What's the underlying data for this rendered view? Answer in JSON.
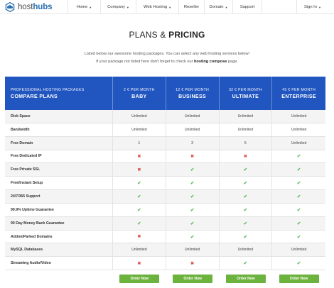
{
  "brand": {
    "prefix": "host",
    "suffix": "hubs",
    "icon": "cloud-icon",
    "accent": "#2a6fb0"
  },
  "nav": {
    "items": [
      {
        "label": "Home",
        "dropdown": true
      },
      {
        "label": "Company",
        "dropdown": true
      },
      {
        "label": "Web Hosting",
        "dropdown": true
      },
      {
        "label": "Reseller",
        "dropdown": false
      },
      {
        "label": "Domain",
        "dropdown": true
      },
      {
        "label": "Support",
        "dropdown": false
      }
    ],
    "signin": "Sign In"
  },
  "page": {
    "title_part1": "PLANS & ",
    "title_part2": "PRICING",
    "intro_line1": "Listed below our awesome hosting packages. You can select any web hosting services below!",
    "intro_line2_pre": "If your package not listed here don't forget to check our ",
    "intro_line2_bold": "hosting compose",
    "intro_line2_post": " page."
  },
  "table": {
    "header_color": "#2155c0",
    "first_col": {
      "small": "PROFESSIONAL HOSTING PACKAGES",
      "big": "COMPARE PLANS"
    },
    "plans": [
      {
        "price": "2 € PER MONTH",
        "name": "BABY"
      },
      {
        "price": "12 € PER MONTH",
        "name": "BUSINESS"
      },
      {
        "price": "32 € PER MONTH",
        "name": "ULTIMATE"
      },
      {
        "price": "45 € PER MONTH",
        "name": "ENTERPRISE"
      }
    ],
    "rows": [
      {
        "label": "Disk Space",
        "values": [
          "Unlimited",
          "Unlimited",
          "Unlimited",
          "Unlimited"
        ]
      },
      {
        "label": "Bandwidth",
        "values": [
          "Unlimited",
          "Unlimited",
          "Unlimited",
          "Unlimited"
        ]
      },
      {
        "label": "Free Domain",
        "values": [
          "1",
          "3",
          "5",
          "Unlimited"
        ]
      },
      {
        "label": "Free Dedicated IP",
        "values": [
          "no",
          "no",
          "no",
          "yes"
        ]
      },
      {
        "label": "Free Private SSL",
        "values": [
          "no",
          "yes",
          "yes",
          "yes"
        ]
      },
      {
        "label": "Free/Instant Setup",
        "values": [
          "yes",
          "yes",
          "yes",
          "yes"
        ]
      },
      {
        "label": "24/7/365 Support",
        "values": [
          "yes",
          "yes",
          "yes",
          "yes"
        ]
      },
      {
        "label": "99.9% Uptime Guarantee",
        "values": [
          "yes",
          "yes",
          "yes",
          "yes"
        ]
      },
      {
        "label": "90 Day Money Back Guarantee",
        "values": [
          "yes",
          "yes",
          "yes",
          "yes"
        ]
      },
      {
        "label": "Addon/Parked Domains",
        "values": [
          "no",
          "yes",
          "yes",
          "yes"
        ]
      },
      {
        "label": "MySQL Databases",
        "values": [
          "Unlimited",
          "Unlimited",
          "Unlimited",
          "Unlimited"
        ]
      },
      {
        "label": "Streaming Audio/Video",
        "values": [
          "no",
          "no",
          "yes",
          "yes"
        ]
      }
    ],
    "order_label": "Order Now",
    "button_color": "#6cb33e"
  }
}
